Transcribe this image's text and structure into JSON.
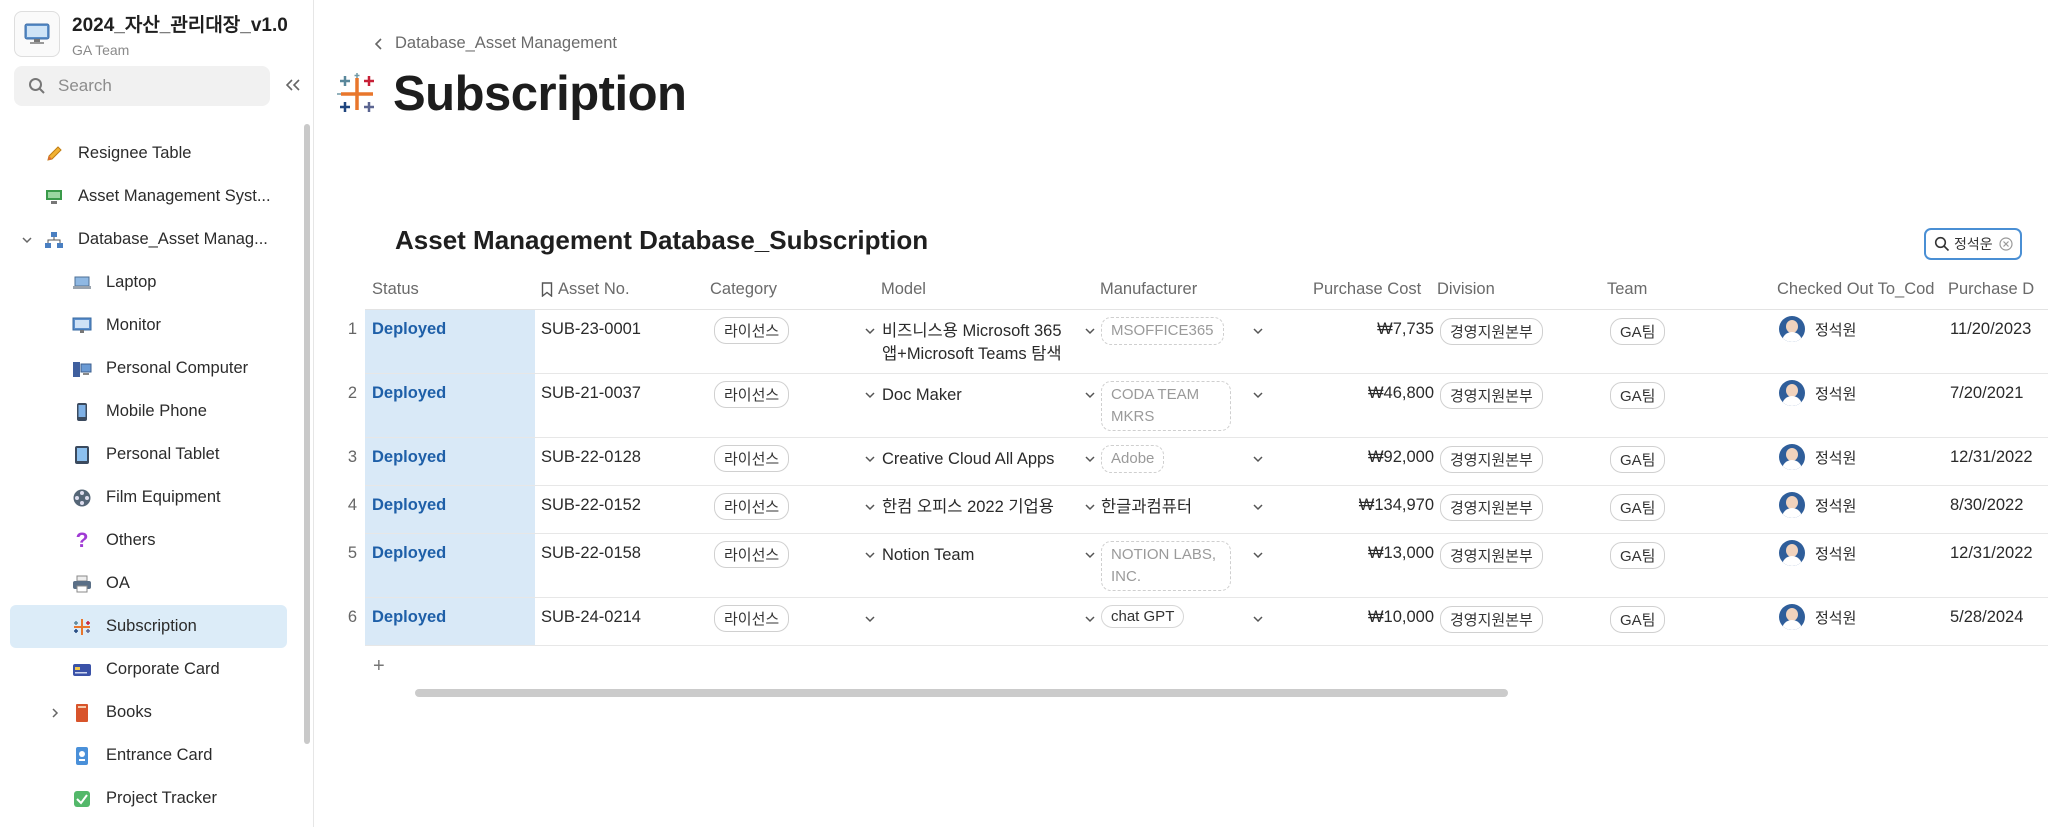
{
  "workspace": {
    "title": "2024_자산_관리대장_v1.0",
    "subtitle": "GA Team"
  },
  "search": {
    "placeholder": "Search"
  },
  "sidebar": {
    "items": [
      {
        "label": "Resignee Table",
        "icon": "pencil-icon",
        "level": 1
      },
      {
        "label": "Asset Management Syst...",
        "icon": "monitor-green-icon",
        "level": 1
      },
      {
        "label": "Database_Asset Manag...",
        "icon": "hierarchy-icon",
        "level": 1,
        "expanded": true
      },
      {
        "label": "Laptop",
        "icon": "laptop-icon",
        "level": 2
      },
      {
        "label": "Monitor",
        "icon": "monitor-icon",
        "level": 2
      },
      {
        "label": "Personal Computer",
        "icon": "desktop-pc-icon",
        "level": 2
      },
      {
        "label": "Mobile Phone",
        "icon": "phone-icon",
        "level": 2
      },
      {
        "label": "Personal Tablet",
        "icon": "tablet-icon",
        "level": 2
      },
      {
        "label": "Film Equipment",
        "icon": "film-reel-icon",
        "level": 2
      },
      {
        "label": "Others",
        "icon": "question-icon",
        "level": 2
      },
      {
        "label": "OA",
        "icon": "printer-icon",
        "level": 2
      },
      {
        "label": "Subscription",
        "icon": "tableau-icon",
        "level": 2,
        "active": true
      },
      {
        "label": "Corporate Card",
        "icon": "credit-card-icon",
        "level": 2
      },
      {
        "label": "Books",
        "icon": "book-icon",
        "level": 2,
        "collapsed": true
      },
      {
        "label": "Entrance Card",
        "icon": "id-card-icon",
        "level": 2
      },
      {
        "label": "Project Tracker",
        "icon": "check-icon",
        "level": 2
      }
    ]
  },
  "breadcrumb": {
    "text": "Database_Asset Management"
  },
  "page": {
    "title": "Subscription"
  },
  "database": {
    "title": "Asset Management Database_Subscription"
  },
  "filter": {
    "value": "정석운"
  },
  "table": {
    "columns": [
      "Status",
      "Asset No.",
      "Category",
      "Model",
      "Manufacturer",
      "Purchase Cost",
      "Division",
      "Team",
      "Checked Out To_Cod",
      "Purchase D"
    ],
    "rows": [
      {
        "num": "1",
        "status": "Deployed",
        "asset": "SUB-23-0001",
        "category": "라이선스",
        "model": "비즈니스용 Microsoft 365 앱+Microsoft Teams 탐색",
        "manufacturer": "MSOFFICE365",
        "mfr_style": "dashed",
        "cost": "₩7,735",
        "division": "경영지원본부",
        "team": "GA팀",
        "person": "정석원",
        "date": "11/20/2023"
      },
      {
        "num": "2",
        "status": "Deployed",
        "asset": "SUB-21-0037",
        "category": "라이선스",
        "model": "Doc Maker",
        "manufacturer": "CODA TEAM MKRS",
        "mfr_style": "dashed",
        "cost": "₩46,800",
        "division": "경영지원본부",
        "team": "GA팀",
        "person": "정석원",
        "date": "7/20/2021"
      },
      {
        "num": "3",
        "status": "Deployed",
        "asset": "SUB-22-0128",
        "category": "라이선스",
        "model": "Creative Cloud All Apps",
        "manufacturer": "Adobe",
        "mfr_style": "dashed",
        "cost": "₩92,000",
        "division": "경영지원본부",
        "team": "GA팀",
        "person": "정석원",
        "date": "12/31/2022"
      },
      {
        "num": "4",
        "status": "Deployed",
        "asset": "SUB-22-0152",
        "category": "라이선스",
        "model": "한컴 오피스 2022 기업용",
        "manufacturer": "한글과컴퓨터",
        "mfr_style": "text",
        "cost": "₩134,970",
        "division": "경영지원본부",
        "team": "GA팀",
        "person": "정석원",
        "date": "8/30/2022"
      },
      {
        "num": "5",
        "status": "Deployed",
        "asset": "SUB-22-0158",
        "category": "라이선스",
        "model": "Notion Team",
        "manufacturer": "NOTION LABS, INC.",
        "mfr_style": "dashed",
        "cost": "₩13,000",
        "division": "경영지원본부",
        "team": "GA팀",
        "person": "정석원",
        "date": "12/31/2022"
      },
      {
        "num": "6",
        "status": "Deployed",
        "asset": "SUB-24-0214",
        "category": "라이선스",
        "model": "",
        "manufacturer": "chat GPT",
        "mfr_style": "solid",
        "cost": "₩10,000",
        "division": "경영지원본부",
        "team": "GA팀",
        "person": "정석원",
        "date": "5/28/2024"
      }
    ]
  },
  "add_row": {
    "label": "+"
  },
  "colors": {
    "accent": "#1e5fa8",
    "status_bg": "#d9e9f7",
    "active_nav": "#dcecf8",
    "filter_border": "#4a8fd4"
  }
}
